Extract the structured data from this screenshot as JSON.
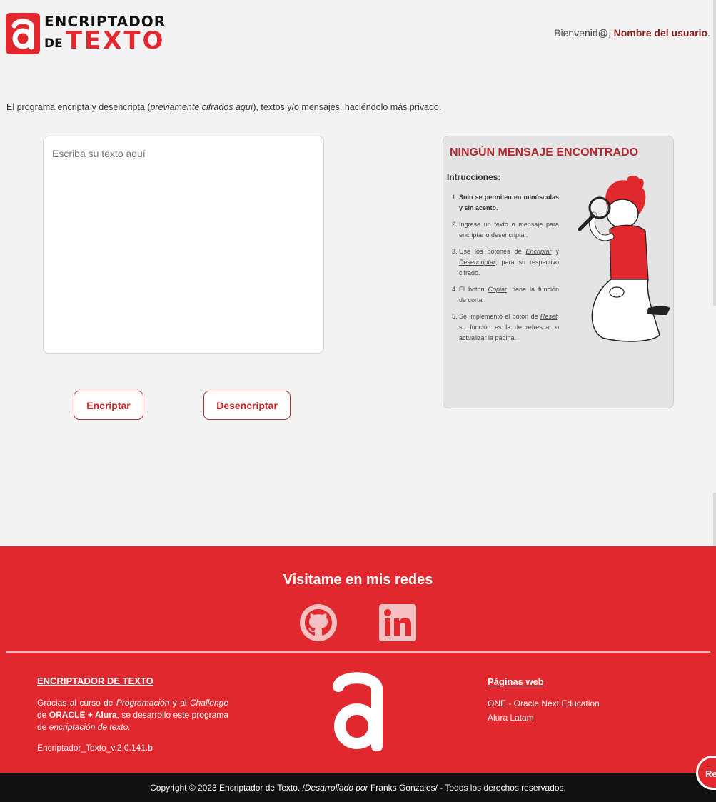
{
  "header": {
    "logo_line1": "ENCRIPTADOR",
    "logo_de": "DE",
    "logo_texto": "TEXTO",
    "welcome_prefix": "Bienvenid@, ",
    "user_name": "Nombre del usuario",
    "welcome_suffix": "."
  },
  "intro": {
    "part1": "El programa encripta y desencripta (",
    "italic": "previamente cifrados aquí",
    "part2": "), textos y/o mensajes, haciéndolo más privado."
  },
  "editor": {
    "placeholder": "Escriba su texto aquí",
    "value": ""
  },
  "buttons": {
    "encrypt": "Encriptar",
    "decrypt": "Desencriptar"
  },
  "panel": {
    "title": "NINGÚN MENSAJE ENCONTRADO",
    "subtitle": "Intrucciones:",
    "step1": "Solo se permiten en minúsculas y sin acento.",
    "step2": "Ingrese un texto o mensaje para encriptar o desencriptar.",
    "step3_a": "Use los botones de ",
    "step3_enc": "Encriptar",
    "step3_b": " y ",
    "step3_dec": "Desencriptar",
    "step3_c": ", para su respectivo cifrado.",
    "step4_a": "El boton ",
    "step4_copy": "Copiar",
    "step4_b": ", tiene la función de cortar.",
    "step5_a": "Se implementó el botón de ",
    "step5_reset": "Reset",
    "step5_b": ", su función es la de refrescar o actualizar la página."
  },
  "footer": {
    "social_title": "Visitame en mis redes",
    "social_icons": [
      "github-icon",
      "linkedin-icon"
    ],
    "col1_title": "ENCRIPTADOR DE TEXTO",
    "col1_t1": "Gracias al curso de ",
    "col1_prog": "Programación",
    "col1_t2": " y al ",
    "col1_chal": "Challenge",
    "col1_t3": " de ",
    "col1_oracle": "ORACLE + Alura",
    "col1_t4": ", se desarrollo este programa de ",
    "col1_enc": "encriptación de texto.",
    "version": "Encriptador_Texto_v.2.0.141.b",
    "col3_title": "Páginas web",
    "links": [
      "ONE - Oracle Next Education",
      "Alura Latam"
    ]
  },
  "copyright": {
    "part1": "Copyright © 2023 Encriptador de Texto. /",
    "italic": "Desarrollado por",
    "part2": " Franks Gonzales/ - Todos los derechos reservados."
  },
  "reset_label": "Res",
  "colors": {
    "brand_red": "#e0282e",
    "dark_red": "#8c1d1d",
    "panel_bg": "#e4e4e4"
  }
}
